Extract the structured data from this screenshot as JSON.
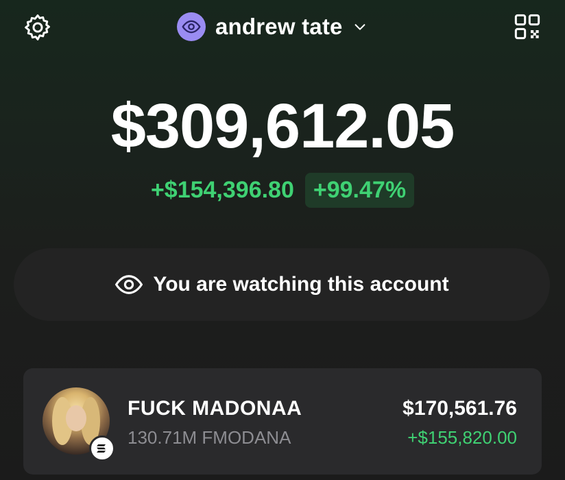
{
  "header": {
    "settings_icon": "gear-icon",
    "account_name": "andrew tate",
    "account_avatar_icon": "eye-icon",
    "switch_icon": "chevron-down-icon",
    "qr_icon": "qr-code-icon"
  },
  "portfolio": {
    "balance": "$309,612.05",
    "change_amount": "+$154,396.80",
    "change_percent": "+99.47%"
  },
  "watch_banner": {
    "icon": "eye-icon",
    "text": "You are watching this account"
  },
  "tokens": [
    {
      "name": "FUCK MADONAA",
      "quantity": "130.71M FMODANA",
      "value": "$170,561.76",
      "change": "+$155,820.00",
      "chain_icon": "solana-icon"
    }
  ],
  "colors": {
    "positive": "#3fd173",
    "avatar_bg": "#9a8cf2",
    "card_bg": "#2a2a2c",
    "banner_bg": "#232323"
  }
}
